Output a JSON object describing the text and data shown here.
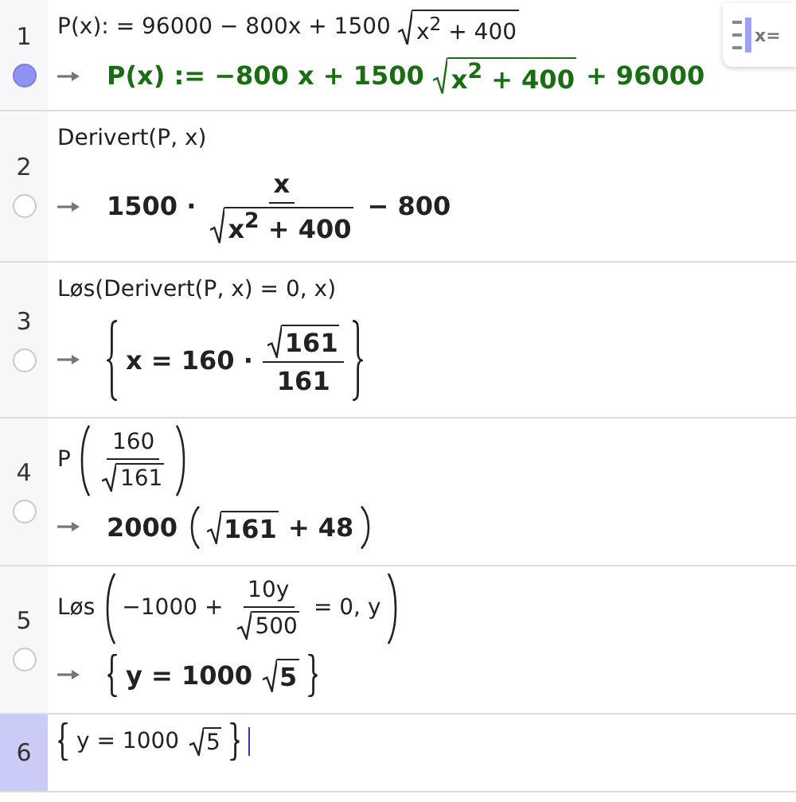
{
  "toolbar_button": {
    "label": "x="
  },
  "rows": [
    {
      "number": "1",
      "active": false,
      "visible": true,
      "input": [
        {
          "kind": "text",
          "text": "P(x): = 96000 − 800x + 1500"
        },
        {
          "kind": "sqrt",
          "children": [
            {
              "kind": "text",
              "text": "x$^{2}$ + 400"
            }
          ]
        }
      ],
      "output": {
        "kind": "definition",
        "expr": [
          {
            "kind": "text",
            "text": "P(x) := −800 x + 1500"
          },
          {
            "kind": "sqrt",
            "children": [
              {
                "kind": "text",
                "text": "x$^{2}$ + 400"
              }
            ]
          },
          {
            "kind": "text",
            "text": "+ 96000"
          }
        ]
      }
    },
    {
      "number": "2",
      "active": false,
      "visible": false,
      "input": [
        {
          "kind": "text",
          "text": "Derivert(P, x)"
        }
      ],
      "output": {
        "kind": "result",
        "expr": [
          {
            "kind": "text",
            "text": "1500 ·"
          },
          {
            "kind": "frac",
            "num": [
              {
                "kind": "text",
                "text": "x"
              }
            ],
            "den": [
              {
                "kind": "sqrt",
                "children": [
                  {
                    "kind": "text",
                    "text": "x$^{2}$ + 400"
                  }
                ]
              }
            ]
          },
          {
            "kind": "text",
            "text": "− 800"
          }
        ]
      }
    },
    {
      "number": "3",
      "active": false,
      "visible": false,
      "input": [
        {
          "kind": "text",
          "text": "Løs(Derivert(P, x) = 0, x)"
        }
      ],
      "output": {
        "kind": "result",
        "expr": [
          {
            "kind": "brace",
            "children": [
              {
                "kind": "text",
                "text": "x = 160 ·"
              },
              {
                "kind": "frac",
                "num": [
                  {
                    "kind": "sqrt",
                    "children": [
                      {
                        "kind": "text",
                        "text": "161"
                      }
                    ]
                  }
                ],
                "den": [
                  {
                    "kind": "text",
                    "text": "161"
                  }
                ]
              }
            ]
          }
        ]
      }
    },
    {
      "number": "4",
      "active": false,
      "visible": false,
      "input": [
        {
          "kind": "text",
          "text": "P"
        },
        {
          "kind": "paren",
          "children": [
            {
              "kind": "frac",
              "num": [
                {
                  "kind": "text",
                  "text": "160"
                }
              ],
              "den": [
                {
                  "kind": "sqrt",
                  "children": [
                    {
                      "kind": "text",
                      "text": "161"
                    }
                  ]
                }
              ]
            }
          ]
        }
      ],
      "output": {
        "kind": "result",
        "expr": [
          {
            "kind": "text",
            "text": "2000"
          },
          {
            "kind": "paren",
            "children": [
              {
                "kind": "sqrt",
                "children": [
                  {
                    "kind": "text",
                    "text": "161"
                  }
                ]
              },
              {
                "kind": "text",
                "text": "+ 48"
              }
            ]
          }
        ]
      }
    },
    {
      "number": "5",
      "active": false,
      "visible": false,
      "input": [
        {
          "kind": "text",
          "text": "Løs"
        },
        {
          "kind": "paren",
          "children": [
            {
              "kind": "text",
              "text": "−1000 +"
            },
            {
              "kind": "frac",
              "num": [
                {
                  "kind": "text",
                  "text": "10y"
                }
              ],
              "den": [
                {
                  "kind": "sqrt",
                  "children": [
                    {
                      "kind": "text",
                      "text": "500"
                    }
                  ]
                }
              ]
            },
            {
              "kind": "text",
              "text": "= 0, y"
            }
          ]
        }
      ],
      "output": {
        "kind": "result",
        "expr": [
          {
            "kind": "brace",
            "children": [
              {
                "kind": "text",
                "text": "y = 1000"
              },
              {
                "kind": "sqrt",
                "children": [
                  {
                    "kind": "text",
                    "text": "5"
                  }
                ]
              }
            ]
          }
        ]
      }
    },
    {
      "number": "6",
      "active": true,
      "input": [
        {
          "kind": "brace",
          "children": [
            {
              "kind": "text",
              "text": "y = 1000"
            },
            {
              "kind": "sqrt",
              "children": [
                {
                  "kind": "text",
                  "text": "5"
                }
              ]
            }
          ]
        }
      ]
    }
  ]
}
